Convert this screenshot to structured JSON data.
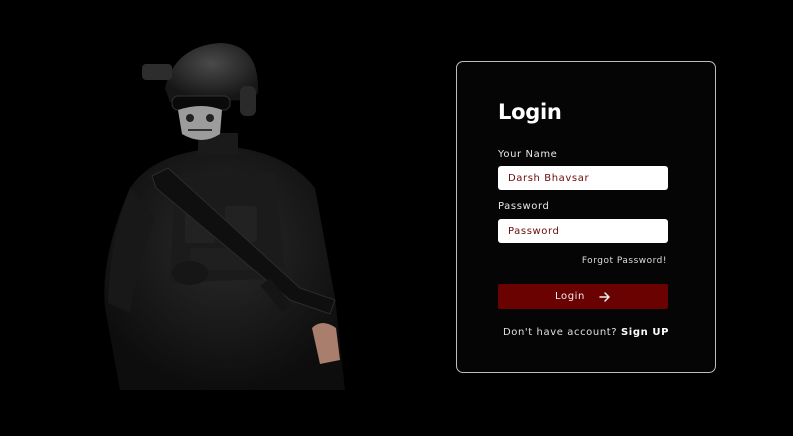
{
  "login": {
    "title": "Login",
    "name_label": "Your Name",
    "name_value": "Darsh Bhavsar",
    "password_label": "Password",
    "password_placeholder": "Password",
    "forgot_label": "Forgot Password!",
    "button_label": "Login",
    "button_icon": "arrow-right-icon",
    "signup_prompt": "Don't have account?",
    "signup_link": "Sign UP"
  },
  "colors": {
    "background": "#000000",
    "card_border": "#bdbdbd",
    "button": "#6a0202",
    "input_text": "#6b0a0a"
  }
}
